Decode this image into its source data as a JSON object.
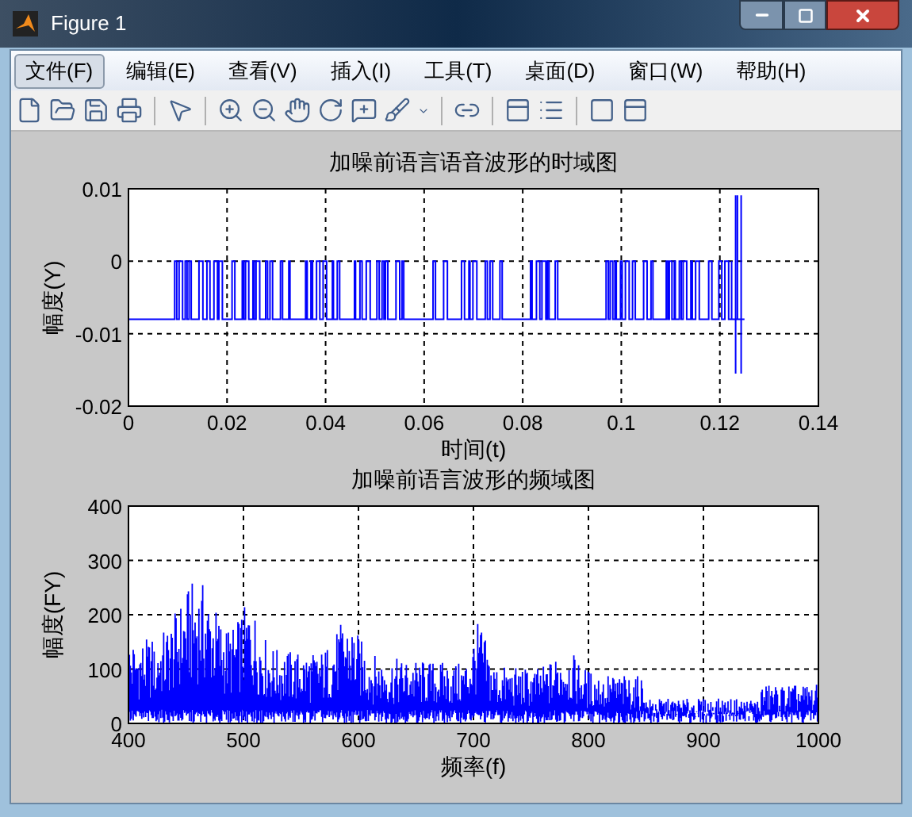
{
  "window": {
    "title": "Figure 1"
  },
  "menu": [
    {
      "label": "文件(F)",
      "selected": true
    },
    {
      "label": "编辑(E)",
      "selected": false
    },
    {
      "label": "查看(V)",
      "selected": false
    },
    {
      "label": "插入(I)",
      "selected": false
    },
    {
      "label": "工具(T)",
      "selected": false
    },
    {
      "label": "桌面(D)",
      "selected": false
    },
    {
      "label": "窗口(W)",
      "selected": false
    },
    {
      "label": "帮助(H)",
      "selected": false
    }
  ],
  "plots": [
    {
      "kind": "time",
      "title": "加噪前语言语音波形的时域图",
      "ylabel": "幅度(Y)",
      "xlabel": "时间(t)",
      "xticks": [
        "0",
        "0.02",
        "0.04",
        "0.06",
        "0.08",
        "0.1",
        "0.12",
        "0.14"
      ],
      "yticks": [
        "0.01",
        "0",
        "-0.01",
        "-0.02"
      ]
    },
    {
      "kind": "spectrum",
      "title": "加噪前语言波形的频域图",
      "ylabel": "幅度(FY)",
      "xlabel": "频率(f)",
      "xticks": [
        "400",
        "500",
        "600",
        "700",
        "800",
        "900",
        "1000"
      ],
      "yticks": [
        "400",
        "300",
        "200",
        "100",
        "0"
      ]
    }
  ]
}
